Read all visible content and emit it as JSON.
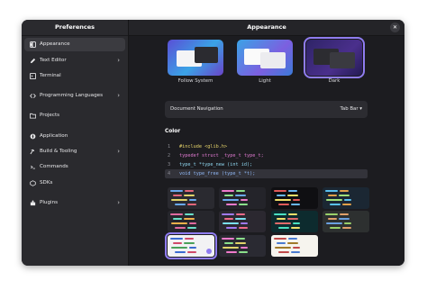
{
  "sidebar": {
    "title": "Preferences",
    "items": [
      {
        "label": "Appearance",
        "icon": "appearance-icon",
        "chevron": false
      },
      {
        "label": "Text Editor",
        "icon": "pencil-icon",
        "chevron": true
      },
      {
        "label": "Terminal",
        "icon": "terminal-icon",
        "chevron": false
      },
      {
        "label": "Programming Languages",
        "icon": "code-icon",
        "chevron": true
      },
      {
        "label": "Projects",
        "icon": "folder-icon",
        "chevron": false
      },
      {
        "label": "Application",
        "icon": "application-icon",
        "chevron": false
      },
      {
        "label": "Build & Tooling",
        "icon": "hammer-icon",
        "chevron": true
      },
      {
        "label": "Commands",
        "icon": "commands-icon",
        "chevron": false
      },
      {
        "label": "SDKs",
        "icon": "sdk-icon",
        "chevron": false
      },
      {
        "label": "Plugins",
        "icon": "plugin-icon",
        "chevron": true
      }
    ]
  },
  "main": {
    "title": "Appearance",
    "close_icon": "close-icon",
    "themes": [
      {
        "label": "Follow System"
      },
      {
        "label": "Light"
      },
      {
        "label": "Dark",
        "selected": true
      }
    ],
    "doc_nav": {
      "label": "Document Navigation",
      "value": "Tab Bar"
    },
    "color_title": "Color",
    "code_lines": [
      {
        "n": "1",
        "text": "#include <glib.h>"
      },
      {
        "n": "2",
        "text": "typedef struct _type_t type_t;"
      },
      {
        "n": "3",
        "text": "type_t *type_new (int id);"
      },
      {
        "n": "4",
        "text": "void type_free (type_t *t);"
      }
    ],
    "accent": "#8f7cf0"
  }
}
